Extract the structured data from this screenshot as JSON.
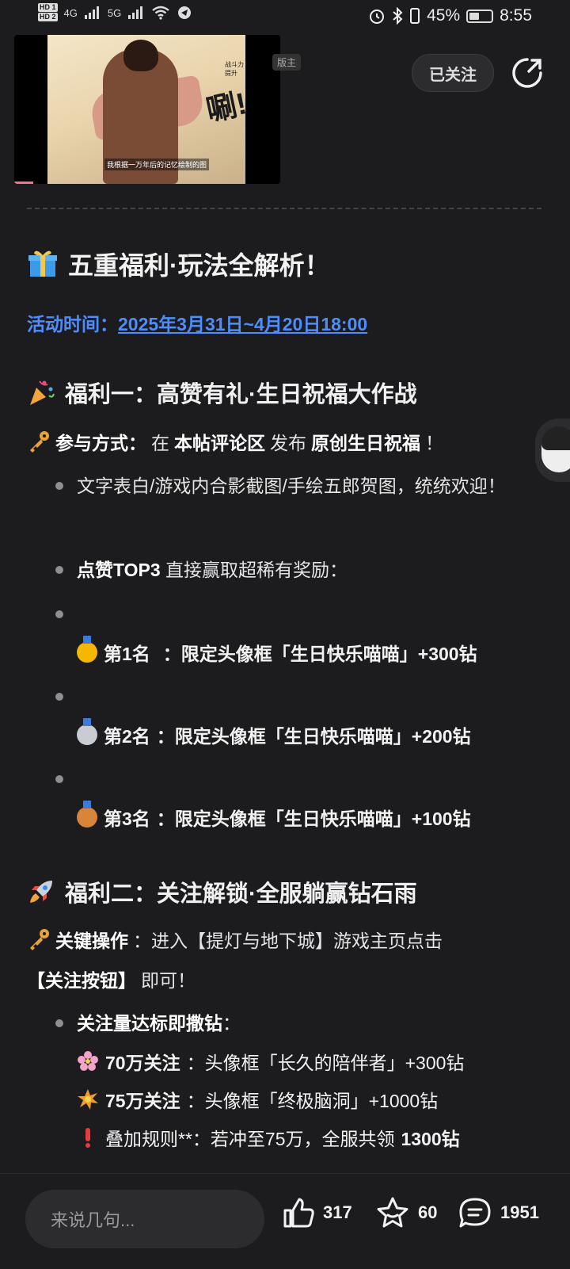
{
  "status_bar": {
    "hd1": "HD 1",
    "hd2": "HD 2",
    "net1": "4G",
    "net2": "5G",
    "battery": "45%",
    "time": "8:55"
  },
  "header": {
    "mod_badge": "版主",
    "follow_label": "已关注",
    "video_caption": "我根据一万年后的记忆绘制的图",
    "video_tag": "战斗力提升",
    "video_sfx": "唰!"
  },
  "post": {
    "title": "五重福利·玩法全解析！",
    "time_label": "活动时间：",
    "time_value": "2025年3月31日~4月20日18:00",
    "sections": {
      "one": {
        "heading": "福利一：高赞有礼·生日祝福大作战",
        "join_label": "参与方式：",
        "join_parts": [
          "在",
          "本帖评论区",
          "发布",
          "原创生日祝福",
          "！"
        ],
        "bullet1": "文字表白/游戏内合影截图/手绘五郎贺图，统统欢迎！",
        "bullet2_bold": "点赞TOP3",
        "bullet2_rest": "直接赢取超稀有奖励：",
        "ranks": [
          {
            "name": "第1名",
            "prize": "：限定头像框「生日快乐喵喵」+300钻"
          },
          {
            "name": "第2名",
            "prize": "：限定头像框「生日快乐喵喵」+200钻"
          },
          {
            "name": "第3名",
            "prize": "：限定头像框「生日快乐喵喵」+100钻"
          }
        ]
      },
      "two": {
        "heading": "福利二：关注解锁·全服躺赢钻石雨",
        "op_label": "关键操作",
        "op_text": "：进入【提灯与地下城】游戏主页点击",
        "op_line2_bold": "【关注按钮】",
        "op_line2_rest": "即可！",
        "bullet_bold": "关注量达标即撒钻",
        "bullet_rest": "：",
        "tier1_bold": "70万关注",
        "tier1_rest": "：头像框「长久的陪伴者」+300钻",
        "tier2_bold": "75万关注",
        "tier2_rest": "：头像框「终极脑洞」+1000钻",
        "rule_text": "叠加规则**：若冲至75万，全服共领",
        "rule_bold": "1300钻"
      }
    }
  },
  "bottom": {
    "comment_placeholder": "来说几句...",
    "likes": "317",
    "favorites": "60",
    "comments": "1951"
  },
  "colors": {
    "accent": "#4d8dff",
    "background": "#1c1c1e"
  }
}
